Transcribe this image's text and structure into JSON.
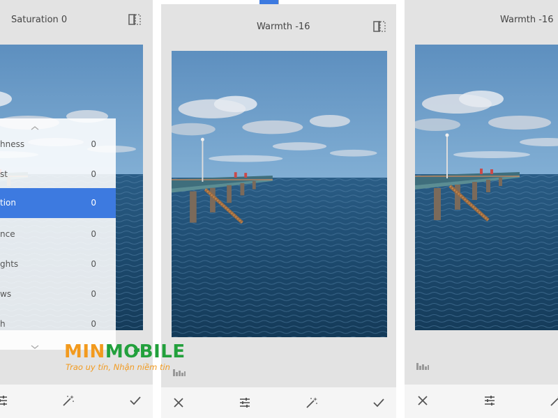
{
  "panels": {
    "left": {
      "title": "Saturation 0",
      "adjust_menu": {
        "items": [
          {
            "label": "hness",
            "value": "0",
            "selected": false
          },
          {
            "label": "st",
            "value": "0",
            "selected": false
          },
          {
            "label": "tion",
            "value": "0",
            "selected": true
          },
          {
            "label": "nce",
            "value": "0",
            "selected": false
          },
          {
            "label": "ghts",
            "value": "0",
            "selected": false
          },
          {
            "label": "ws",
            "value": "0",
            "selected": false
          },
          {
            "label": "h",
            "value": "0",
            "selected": false
          }
        ],
        "up_icon": "chevron-up-icon",
        "down_icon": "chevron-down-icon"
      },
      "toolbar": [
        "tune-icon",
        "magic-wand-icon",
        "check-icon"
      ]
    },
    "middle": {
      "title": "Warmth -16",
      "toolbar": [
        "close-icon",
        "tune-icon",
        "magic-wand-icon",
        "check-icon"
      ]
    },
    "right": {
      "title": "Warmth -16",
      "toolbar": [
        "close-icon",
        "tune-icon",
        "magic-wand-icon"
      ]
    }
  },
  "watermark": {
    "brand_part1": "MIN",
    "brand_part2": "MOBILE",
    "slogan": "Trao uy tín, Nhận niềm tin"
  },
  "colors": {
    "accent": "#3d7ae0",
    "panel_bg": "#e3e3e3",
    "brand_orange": "#f29a1e",
    "brand_green": "#22a03c"
  }
}
